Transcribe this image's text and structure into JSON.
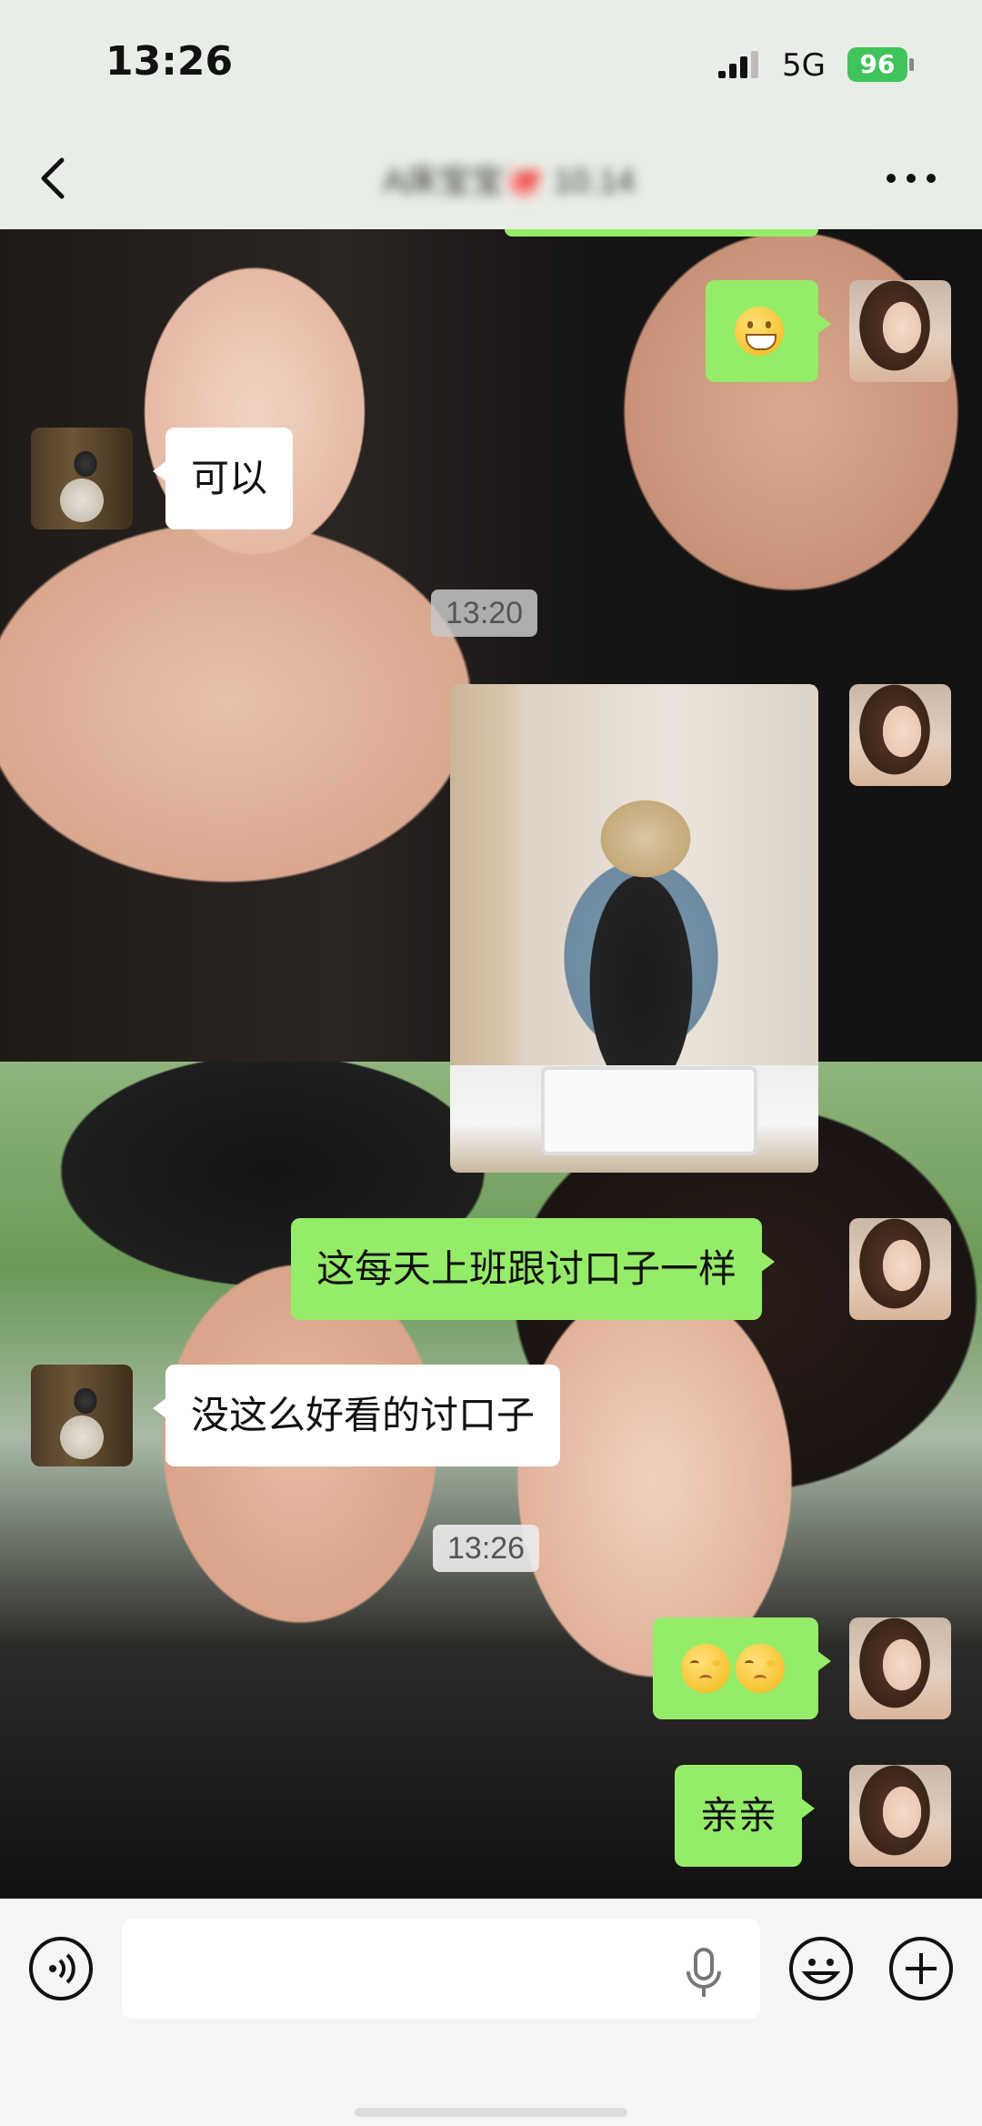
{
  "status_bar": {
    "time": "13:26",
    "network": "5G",
    "battery": "96"
  },
  "header": {
    "title": "A床宝宝🐙 10.14"
  },
  "messages": [
    {
      "type": "emoji",
      "side": "out",
      "emoji": "grin-icon"
    },
    {
      "type": "text",
      "side": "in",
      "text": "可以"
    },
    {
      "type": "timestamp",
      "text": "13:20"
    },
    {
      "type": "image",
      "side": "out"
    },
    {
      "type": "text",
      "side": "out",
      "text": "这每天上班跟讨口子一样"
    },
    {
      "type": "text",
      "side": "in",
      "text": "没这么好看的讨口子"
    },
    {
      "type": "timestamp",
      "text": "13:26"
    },
    {
      "type": "emoji",
      "side": "out",
      "emoji": "shy-face-icon x2"
    },
    {
      "type": "text",
      "side": "out",
      "text": "亲亲"
    }
  ],
  "input": {
    "placeholder": ""
  },
  "colors": {
    "bubble_out": "#95ec69",
    "bubble_in": "#ffffff",
    "battery": "#3fc35b"
  }
}
